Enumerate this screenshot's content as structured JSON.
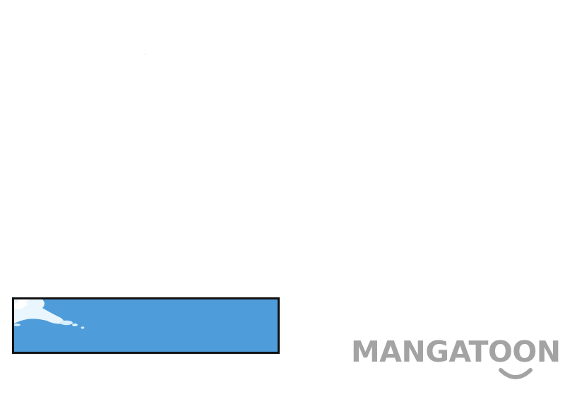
{
  "logo": {
    "text": "MANGATOON",
    "color": "#a3a3a3",
    "smile": "smile-glyph"
  },
  "panel": {
    "fill": "#4f9cdb",
    "border": "#111111",
    "splash": "white-foam-splash"
  }
}
